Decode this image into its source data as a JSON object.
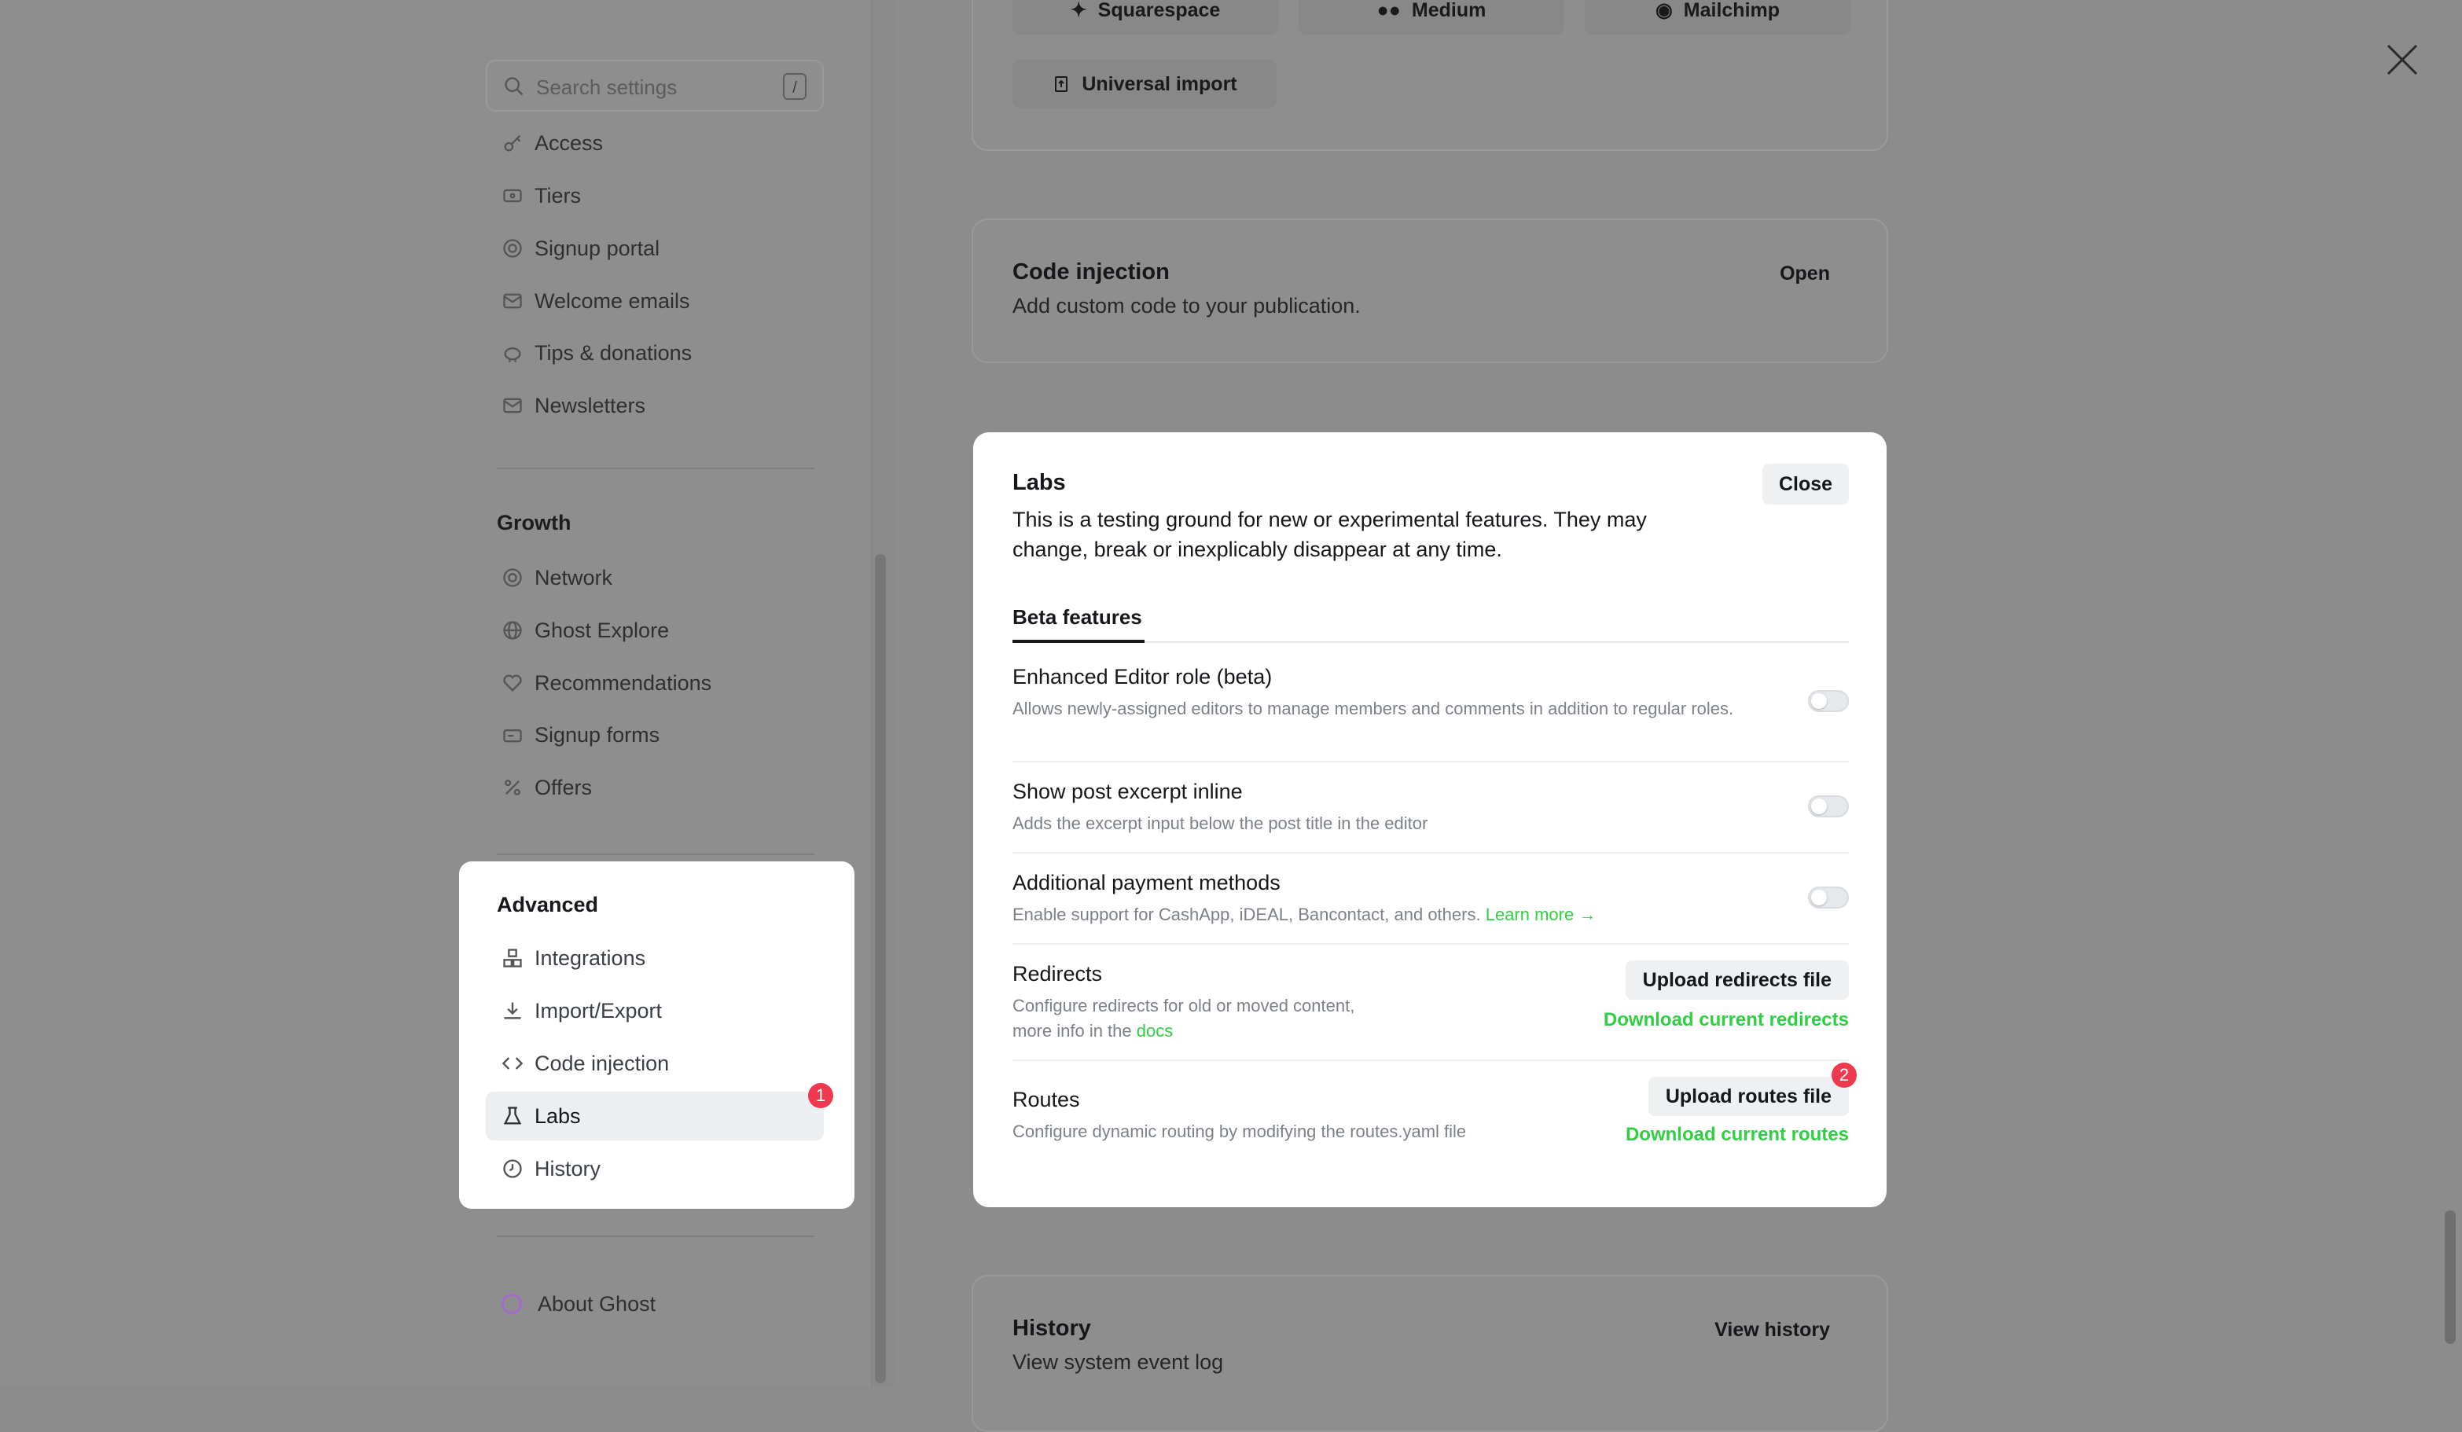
{
  "search": {
    "placeholder": "Search settings",
    "shortcut": "/"
  },
  "sidebar": {
    "membership_items": [
      {
        "label": "Access",
        "icon": "key-icon"
      },
      {
        "label": "Tiers",
        "icon": "tiers-icon"
      },
      {
        "label": "Signup portal",
        "icon": "portal-icon"
      },
      {
        "label": "Welcome emails",
        "icon": "email-icon"
      },
      {
        "label": "Tips & donations",
        "icon": "piggy-bank-icon"
      },
      {
        "label": "Newsletters",
        "icon": "newsletter-icon"
      }
    ],
    "growth": {
      "title": "Growth",
      "items": [
        {
          "label": "Network",
          "icon": "network-icon"
        },
        {
          "label": "Ghost Explore",
          "icon": "globe-icon"
        },
        {
          "label": "Recommendations",
          "icon": "heart-icon"
        },
        {
          "label": "Signup forms",
          "icon": "form-icon"
        },
        {
          "label": "Offers",
          "icon": "percent-icon"
        }
      ]
    },
    "advanced": {
      "title": "Advanced",
      "items": [
        {
          "label": "Integrations",
          "icon": "integrations-icon"
        },
        {
          "label": "Import/Export",
          "icon": "download-icon"
        },
        {
          "label": "Code injection",
          "icon": "code-icon"
        },
        {
          "label": "Labs",
          "icon": "flask-icon",
          "active": true,
          "badge": "1"
        },
        {
          "label": "History",
          "icon": "history-icon"
        }
      ]
    },
    "about": "About Ghost"
  },
  "import_card": {
    "buttons": [
      "Squarespace",
      "Medium",
      "Mailchimp"
    ],
    "universal": "Universal import"
  },
  "code_injection": {
    "title": "Code injection",
    "description": "Add custom code to your publication.",
    "action": "Open"
  },
  "labs": {
    "title": "Labs",
    "description": "This is a testing ground for new or experimental features. They may change, break or inexplicably disappear at any time.",
    "close": "Close",
    "tab": "Beta features",
    "features": [
      {
        "title": "Enhanced Editor role (beta)",
        "description": "Allows newly-assigned editors to manage members and comments in addition to regular roles.",
        "enabled": false
      },
      {
        "title": "Show post excerpt inline",
        "description": "Adds the excerpt input below the post title in the editor",
        "enabled": false
      },
      {
        "title": "Additional payment methods",
        "description": "Enable support for CashApp, iDEAL, Bancontact, and others.",
        "link": "Learn more →",
        "enabled": false
      }
    ],
    "redirects": {
      "title": "Redirects",
      "description_line1": "Configure redirects for old or moved content,",
      "description_line2": "more info in the",
      "docs": "docs",
      "upload": "Upload redirects file",
      "download": "Download current redirects"
    },
    "routes": {
      "title": "Routes",
      "description": "Configure dynamic routing by modifying the routes.yaml file",
      "upload": "Upload routes file",
      "badge": "2",
      "download": "Download current routes"
    }
  },
  "history_card": {
    "title": "History",
    "description": "View system event log",
    "action": "View history"
  },
  "colors": {
    "accent_green": "#30cf43",
    "badge_red": "#f0384f",
    "overlay": "#8e8e8e"
  }
}
